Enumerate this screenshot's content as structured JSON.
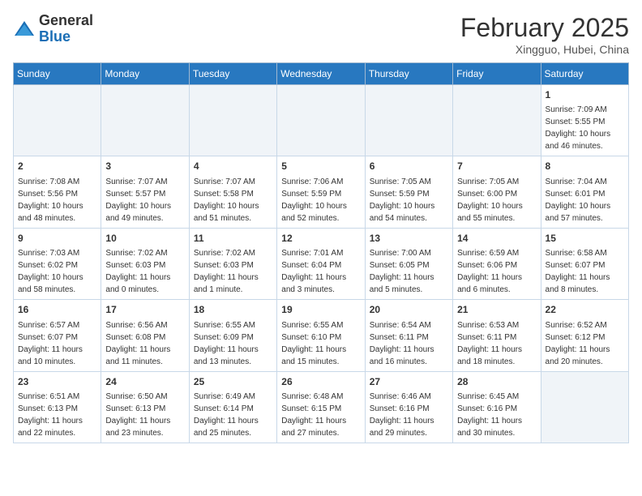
{
  "header": {
    "logo": {
      "general": "General",
      "blue": "Blue"
    },
    "title": "February 2025",
    "location": "Xingguo, Hubei, China"
  },
  "days_of_week": [
    "Sunday",
    "Monday",
    "Tuesday",
    "Wednesday",
    "Thursday",
    "Friday",
    "Saturday"
  ],
  "weeks": [
    [
      {
        "day": "",
        "empty": true
      },
      {
        "day": "",
        "empty": true
      },
      {
        "day": "",
        "empty": true
      },
      {
        "day": "",
        "empty": true
      },
      {
        "day": "",
        "empty": true
      },
      {
        "day": "",
        "empty": true
      },
      {
        "day": "1",
        "sunrise": "Sunrise: 7:09 AM",
        "sunset": "Sunset: 5:55 PM",
        "daylight": "Daylight: 10 hours and 46 minutes."
      }
    ],
    [
      {
        "day": "2",
        "sunrise": "Sunrise: 7:08 AM",
        "sunset": "Sunset: 5:56 PM",
        "daylight": "Daylight: 10 hours and 48 minutes."
      },
      {
        "day": "3",
        "sunrise": "Sunrise: 7:07 AM",
        "sunset": "Sunset: 5:57 PM",
        "daylight": "Daylight: 10 hours and 49 minutes."
      },
      {
        "day": "4",
        "sunrise": "Sunrise: 7:07 AM",
        "sunset": "Sunset: 5:58 PM",
        "daylight": "Daylight: 10 hours and 51 minutes."
      },
      {
        "day": "5",
        "sunrise": "Sunrise: 7:06 AM",
        "sunset": "Sunset: 5:59 PM",
        "daylight": "Daylight: 10 hours and 52 minutes."
      },
      {
        "day": "6",
        "sunrise": "Sunrise: 7:05 AM",
        "sunset": "Sunset: 5:59 PM",
        "daylight": "Daylight: 10 hours and 54 minutes."
      },
      {
        "day": "7",
        "sunrise": "Sunrise: 7:05 AM",
        "sunset": "Sunset: 6:00 PM",
        "daylight": "Daylight: 10 hours and 55 minutes."
      },
      {
        "day": "8",
        "sunrise": "Sunrise: 7:04 AM",
        "sunset": "Sunset: 6:01 PM",
        "daylight": "Daylight: 10 hours and 57 minutes."
      }
    ],
    [
      {
        "day": "9",
        "sunrise": "Sunrise: 7:03 AM",
        "sunset": "Sunset: 6:02 PM",
        "daylight": "Daylight: 10 hours and 58 minutes."
      },
      {
        "day": "10",
        "sunrise": "Sunrise: 7:02 AM",
        "sunset": "Sunset: 6:03 PM",
        "daylight": "Daylight: 11 hours and 0 minutes."
      },
      {
        "day": "11",
        "sunrise": "Sunrise: 7:02 AM",
        "sunset": "Sunset: 6:03 PM",
        "daylight": "Daylight: 11 hours and 1 minute."
      },
      {
        "day": "12",
        "sunrise": "Sunrise: 7:01 AM",
        "sunset": "Sunset: 6:04 PM",
        "daylight": "Daylight: 11 hours and 3 minutes."
      },
      {
        "day": "13",
        "sunrise": "Sunrise: 7:00 AM",
        "sunset": "Sunset: 6:05 PM",
        "daylight": "Daylight: 11 hours and 5 minutes."
      },
      {
        "day": "14",
        "sunrise": "Sunrise: 6:59 AM",
        "sunset": "Sunset: 6:06 PM",
        "daylight": "Daylight: 11 hours and 6 minutes."
      },
      {
        "day": "15",
        "sunrise": "Sunrise: 6:58 AM",
        "sunset": "Sunset: 6:07 PM",
        "daylight": "Daylight: 11 hours and 8 minutes."
      }
    ],
    [
      {
        "day": "16",
        "sunrise": "Sunrise: 6:57 AM",
        "sunset": "Sunset: 6:07 PM",
        "daylight": "Daylight: 11 hours and 10 minutes."
      },
      {
        "day": "17",
        "sunrise": "Sunrise: 6:56 AM",
        "sunset": "Sunset: 6:08 PM",
        "daylight": "Daylight: 11 hours and 11 minutes."
      },
      {
        "day": "18",
        "sunrise": "Sunrise: 6:55 AM",
        "sunset": "Sunset: 6:09 PM",
        "daylight": "Daylight: 11 hours and 13 minutes."
      },
      {
        "day": "19",
        "sunrise": "Sunrise: 6:55 AM",
        "sunset": "Sunset: 6:10 PM",
        "daylight": "Daylight: 11 hours and 15 minutes."
      },
      {
        "day": "20",
        "sunrise": "Sunrise: 6:54 AM",
        "sunset": "Sunset: 6:11 PM",
        "daylight": "Daylight: 11 hours and 16 minutes."
      },
      {
        "day": "21",
        "sunrise": "Sunrise: 6:53 AM",
        "sunset": "Sunset: 6:11 PM",
        "daylight": "Daylight: 11 hours and 18 minutes."
      },
      {
        "day": "22",
        "sunrise": "Sunrise: 6:52 AM",
        "sunset": "Sunset: 6:12 PM",
        "daylight": "Daylight: 11 hours and 20 minutes."
      }
    ],
    [
      {
        "day": "23",
        "sunrise": "Sunrise: 6:51 AM",
        "sunset": "Sunset: 6:13 PM",
        "daylight": "Daylight: 11 hours and 22 minutes."
      },
      {
        "day": "24",
        "sunrise": "Sunrise: 6:50 AM",
        "sunset": "Sunset: 6:13 PM",
        "daylight": "Daylight: 11 hours and 23 minutes."
      },
      {
        "day": "25",
        "sunrise": "Sunrise: 6:49 AM",
        "sunset": "Sunset: 6:14 PM",
        "daylight": "Daylight: 11 hours and 25 minutes."
      },
      {
        "day": "26",
        "sunrise": "Sunrise: 6:48 AM",
        "sunset": "Sunset: 6:15 PM",
        "daylight": "Daylight: 11 hours and 27 minutes."
      },
      {
        "day": "27",
        "sunrise": "Sunrise: 6:46 AM",
        "sunset": "Sunset: 6:16 PM",
        "daylight": "Daylight: 11 hours and 29 minutes."
      },
      {
        "day": "28",
        "sunrise": "Sunrise: 6:45 AM",
        "sunset": "Sunset: 6:16 PM",
        "daylight": "Daylight: 11 hours and 30 minutes."
      },
      {
        "day": "",
        "empty": true
      }
    ]
  ]
}
